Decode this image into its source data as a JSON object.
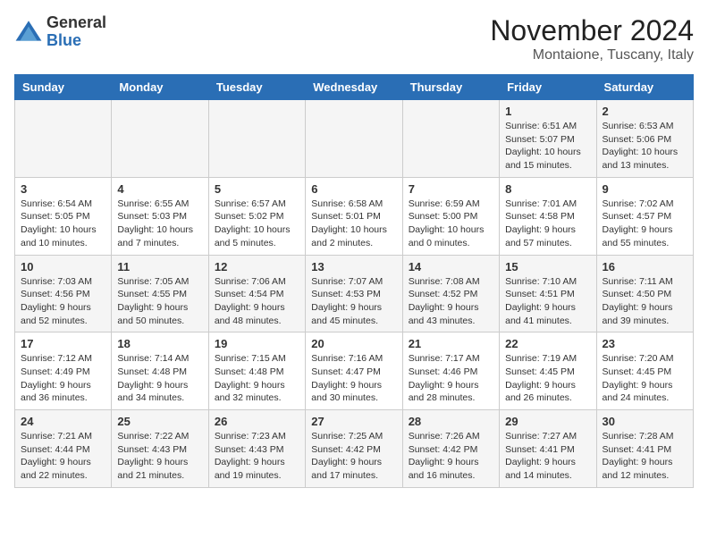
{
  "header": {
    "logo_general": "General",
    "logo_blue": "Blue",
    "month_title": "November 2024",
    "location": "Montaione, Tuscany, Italy"
  },
  "days_of_week": [
    "Sunday",
    "Monday",
    "Tuesday",
    "Wednesday",
    "Thursday",
    "Friday",
    "Saturday"
  ],
  "weeks": [
    [
      {
        "day": "",
        "info": ""
      },
      {
        "day": "",
        "info": ""
      },
      {
        "day": "",
        "info": ""
      },
      {
        "day": "",
        "info": ""
      },
      {
        "day": "",
        "info": ""
      },
      {
        "day": "1",
        "info": "Sunrise: 6:51 AM\nSunset: 5:07 PM\nDaylight: 10 hours\nand 15 minutes."
      },
      {
        "day": "2",
        "info": "Sunrise: 6:53 AM\nSunset: 5:06 PM\nDaylight: 10 hours\nand 13 minutes."
      }
    ],
    [
      {
        "day": "3",
        "info": "Sunrise: 6:54 AM\nSunset: 5:05 PM\nDaylight: 10 hours\nand 10 minutes."
      },
      {
        "day": "4",
        "info": "Sunrise: 6:55 AM\nSunset: 5:03 PM\nDaylight: 10 hours\nand 7 minutes."
      },
      {
        "day": "5",
        "info": "Sunrise: 6:57 AM\nSunset: 5:02 PM\nDaylight: 10 hours\nand 5 minutes."
      },
      {
        "day": "6",
        "info": "Sunrise: 6:58 AM\nSunset: 5:01 PM\nDaylight: 10 hours\nand 2 minutes."
      },
      {
        "day": "7",
        "info": "Sunrise: 6:59 AM\nSunset: 5:00 PM\nDaylight: 10 hours\nand 0 minutes."
      },
      {
        "day": "8",
        "info": "Sunrise: 7:01 AM\nSunset: 4:58 PM\nDaylight: 9 hours\nand 57 minutes."
      },
      {
        "day": "9",
        "info": "Sunrise: 7:02 AM\nSunset: 4:57 PM\nDaylight: 9 hours\nand 55 minutes."
      }
    ],
    [
      {
        "day": "10",
        "info": "Sunrise: 7:03 AM\nSunset: 4:56 PM\nDaylight: 9 hours\nand 52 minutes."
      },
      {
        "day": "11",
        "info": "Sunrise: 7:05 AM\nSunset: 4:55 PM\nDaylight: 9 hours\nand 50 minutes."
      },
      {
        "day": "12",
        "info": "Sunrise: 7:06 AM\nSunset: 4:54 PM\nDaylight: 9 hours\nand 48 minutes."
      },
      {
        "day": "13",
        "info": "Sunrise: 7:07 AM\nSunset: 4:53 PM\nDaylight: 9 hours\nand 45 minutes."
      },
      {
        "day": "14",
        "info": "Sunrise: 7:08 AM\nSunset: 4:52 PM\nDaylight: 9 hours\nand 43 minutes."
      },
      {
        "day": "15",
        "info": "Sunrise: 7:10 AM\nSunset: 4:51 PM\nDaylight: 9 hours\nand 41 minutes."
      },
      {
        "day": "16",
        "info": "Sunrise: 7:11 AM\nSunset: 4:50 PM\nDaylight: 9 hours\nand 39 minutes."
      }
    ],
    [
      {
        "day": "17",
        "info": "Sunrise: 7:12 AM\nSunset: 4:49 PM\nDaylight: 9 hours\nand 36 minutes."
      },
      {
        "day": "18",
        "info": "Sunrise: 7:14 AM\nSunset: 4:48 PM\nDaylight: 9 hours\nand 34 minutes."
      },
      {
        "day": "19",
        "info": "Sunrise: 7:15 AM\nSunset: 4:48 PM\nDaylight: 9 hours\nand 32 minutes."
      },
      {
        "day": "20",
        "info": "Sunrise: 7:16 AM\nSunset: 4:47 PM\nDaylight: 9 hours\nand 30 minutes."
      },
      {
        "day": "21",
        "info": "Sunrise: 7:17 AM\nSunset: 4:46 PM\nDaylight: 9 hours\nand 28 minutes."
      },
      {
        "day": "22",
        "info": "Sunrise: 7:19 AM\nSunset: 4:45 PM\nDaylight: 9 hours\nand 26 minutes."
      },
      {
        "day": "23",
        "info": "Sunrise: 7:20 AM\nSunset: 4:45 PM\nDaylight: 9 hours\nand 24 minutes."
      }
    ],
    [
      {
        "day": "24",
        "info": "Sunrise: 7:21 AM\nSunset: 4:44 PM\nDaylight: 9 hours\nand 22 minutes."
      },
      {
        "day": "25",
        "info": "Sunrise: 7:22 AM\nSunset: 4:43 PM\nDaylight: 9 hours\nand 21 minutes."
      },
      {
        "day": "26",
        "info": "Sunrise: 7:23 AM\nSunset: 4:43 PM\nDaylight: 9 hours\nand 19 minutes."
      },
      {
        "day": "27",
        "info": "Sunrise: 7:25 AM\nSunset: 4:42 PM\nDaylight: 9 hours\nand 17 minutes."
      },
      {
        "day": "28",
        "info": "Sunrise: 7:26 AM\nSunset: 4:42 PM\nDaylight: 9 hours\nand 16 minutes."
      },
      {
        "day": "29",
        "info": "Sunrise: 7:27 AM\nSunset: 4:41 PM\nDaylight: 9 hours\nand 14 minutes."
      },
      {
        "day": "30",
        "info": "Sunrise: 7:28 AM\nSunset: 4:41 PM\nDaylight: 9 hours\nand 12 minutes."
      }
    ]
  ]
}
